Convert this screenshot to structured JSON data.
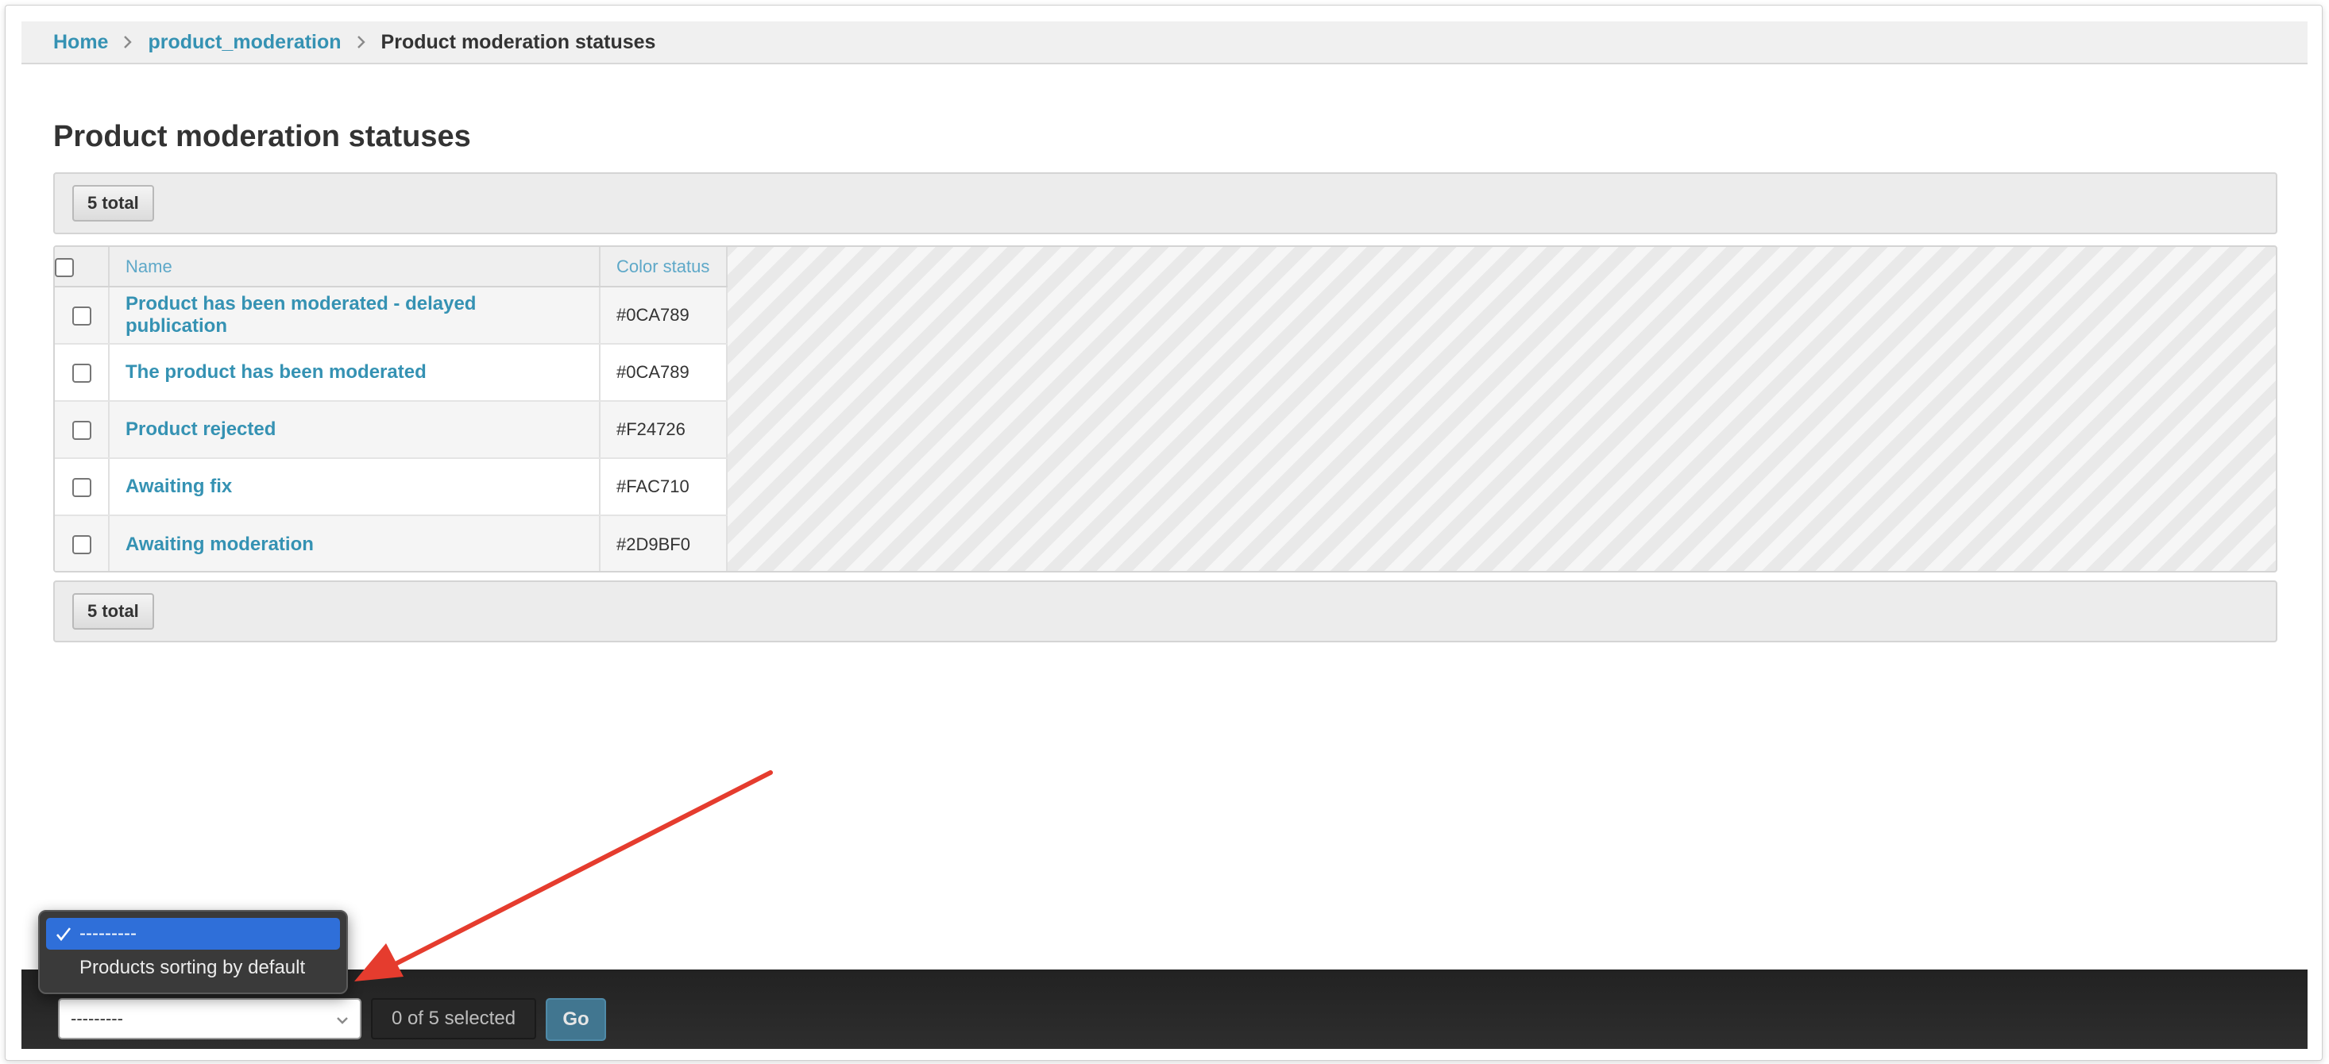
{
  "breadcrumbs": {
    "home": "Home",
    "section": "product_moderation",
    "current": "Product moderation statuses"
  },
  "page": {
    "title": "Product moderation statuses"
  },
  "paginator": {
    "total_label": "5 total"
  },
  "table": {
    "headers": {
      "name": "Name",
      "color": "Color status"
    },
    "rows": [
      {
        "name": "Product has been moderated - delayed publication",
        "color": "#0CA789"
      },
      {
        "name": "The product has been moderated",
        "color": "#0CA789"
      },
      {
        "name": "Product rejected",
        "color": "#F24726"
      },
      {
        "name": "Awaiting fix",
        "color": "#FAC710"
      },
      {
        "name": "Awaiting moderation",
        "color": "#2D9BF0"
      }
    ]
  },
  "actions": {
    "selected_value": "---------",
    "options": [
      "---------",
      "Products sorting by default"
    ],
    "counter": "0 of 5 selected",
    "go_label": "Go"
  },
  "colors": {
    "link": "#3592b3",
    "action_bar": "#2a2a2a",
    "go_button": "#417690",
    "selected_option": "#2f6fd9",
    "annotation_arrow": "#e53c2e"
  }
}
